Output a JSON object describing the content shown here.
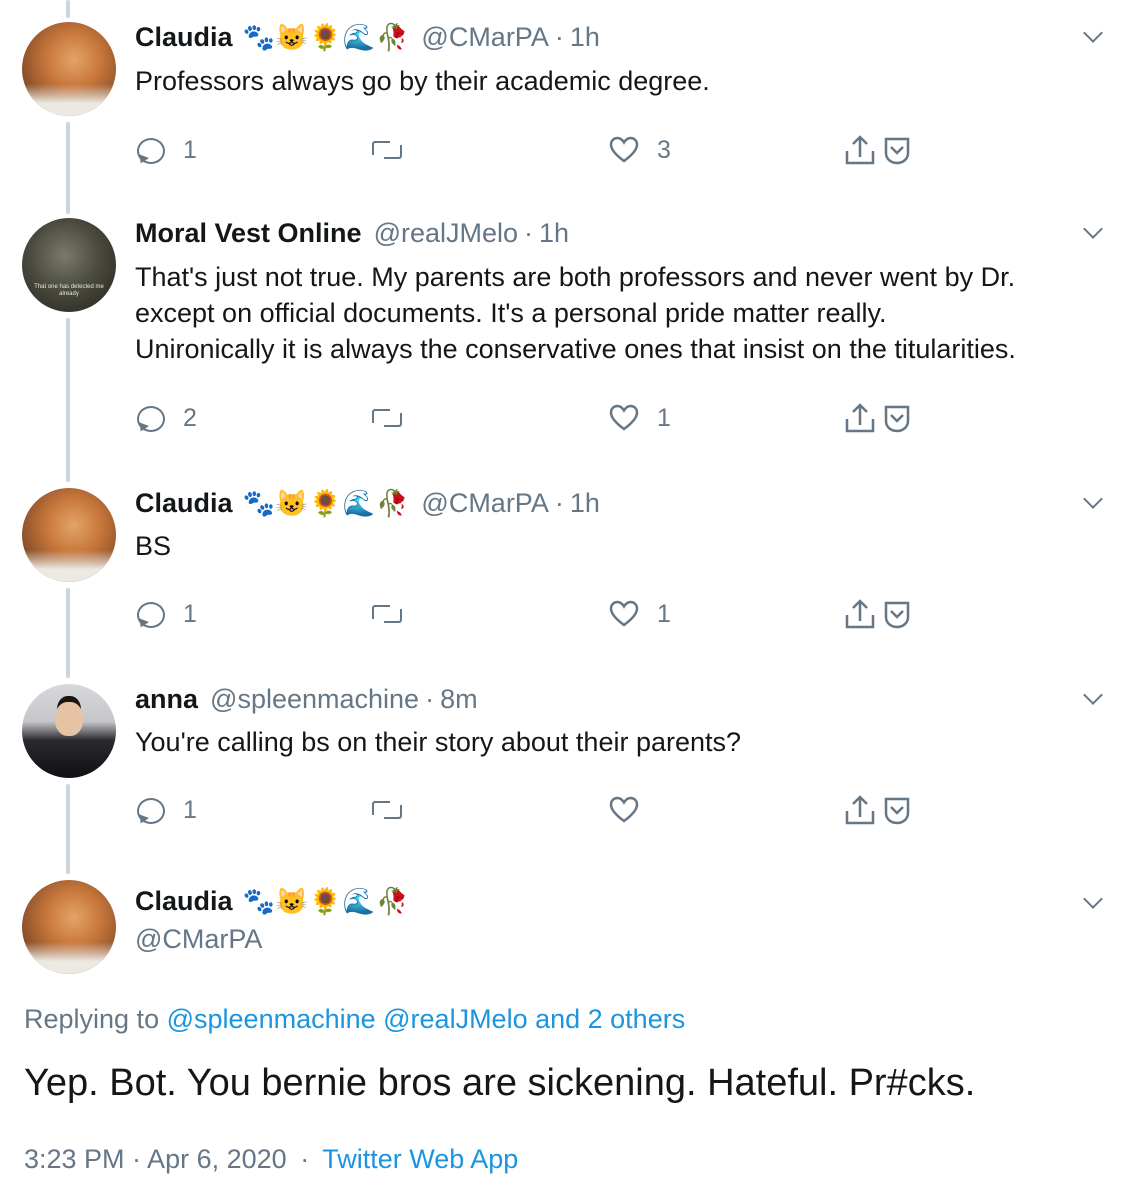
{
  "tweets": [
    {
      "name": "Claudia",
      "emojis": "🐾😺🌻🌊🥀",
      "handle": "@CMarPA",
      "time": "1h",
      "text": [
        "Professors always go by their academic degree."
      ],
      "replies": "1",
      "retweets": "",
      "likes": "3"
    },
    {
      "name": "Moral Vest Online",
      "emojis": "",
      "handle": "@realJMelo",
      "time": "1h",
      "avatar_caption": "That one has detected me already",
      "text": [
        "That's just not true. My parents are both professors and never went by Dr.",
        "except on official documents. It's a personal pride matter really.",
        "Unironically it is always the conservative ones that insist on the titularities."
      ],
      "replies": "2",
      "retweets": "",
      "likes": "1"
    },
    {
      "name": "Claudia",
      "emojis": "🐾😺🌻🌊🥀",
      "handle": "@CMarPA",
      "time": "1h",
      "text": [
        "BS"
      ],
      "replies": "1",
      "retweets": "",
      "likes": "1"
    },
    {
      "name": "anna",
      "emojis": "",
      "handle": "@spleenmachine",
      "time": "8m",
      "text": [
        "You're calling bs on their story about their parents?"
      ],
      "replies": "1",
      "retweets": "",
      "likes": ""
    }
  ],
  "main_tweet": {
    "name": "Claudia",
    "emojis": "🐾😺🌻🌊🥀",
    "handle": "@CMarPA",
    "replying_prefix": "Replying to",
    "replying_to": "@spleenmachine @realJMelo and 2 others",
    "text": "Yep. Bot. You bernie bros are sickening. Hateful. Pr#cks.",
    "timestamp": "3:23 PM · Apr 6, 2020",
    "separator": "·",
    "source": "Twitter Web App"
  },
  "dot": "·",
  "colors": {
    "text": "#14171a",
    "secondary": "#657786",
    "link": "#1b95e0",
    "thread_line": "#ccd6dd"
  },
  "icons": [
    "reply-icon",
    "retweet-icon",
    "like-icon",
    "share-icon",
    "chevron-down-icon"
  ]
}
